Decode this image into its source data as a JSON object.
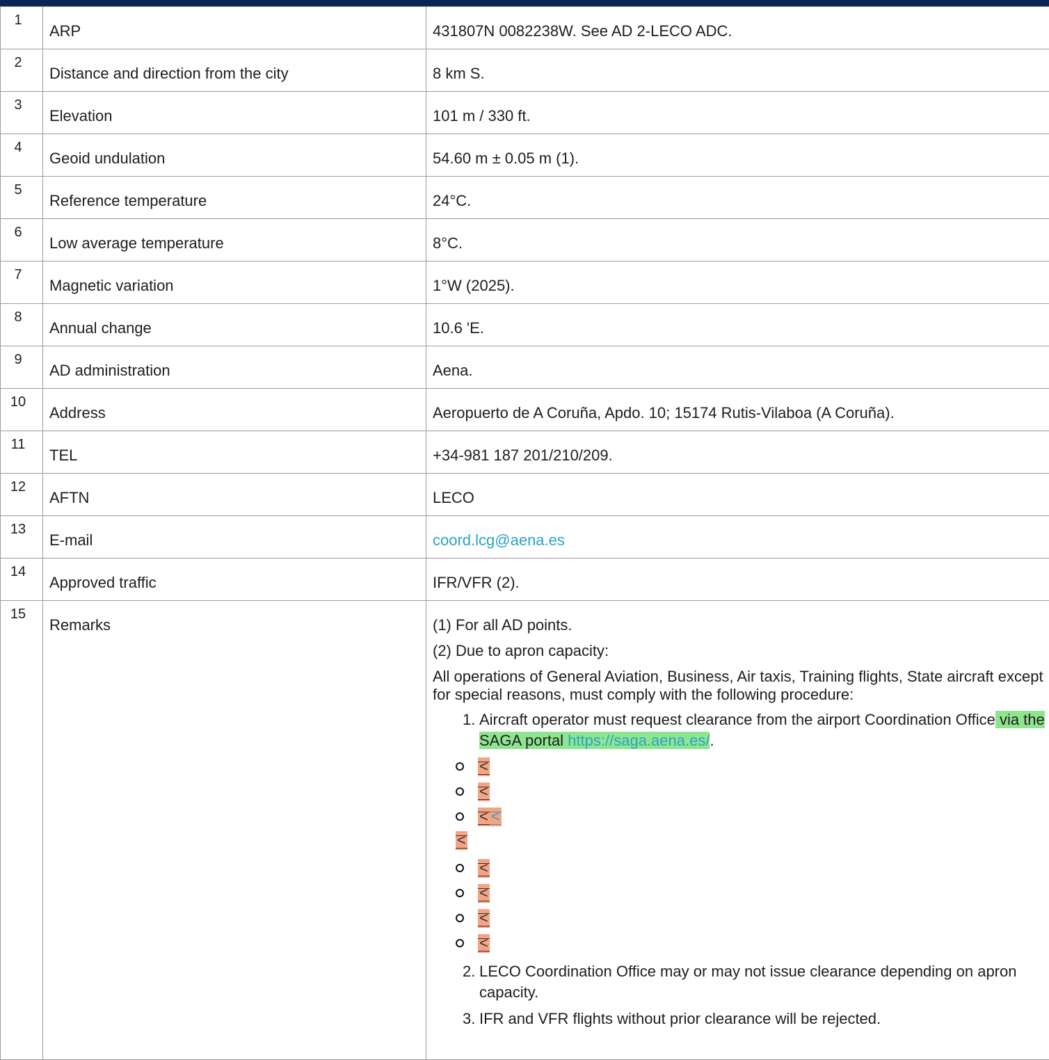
{
  "rows": [
    {
      "num": "1",
      "label": "ARP",
      "value": "431807N 0082238W. See AD 2-LECO ADC."
    },
    {
      "num": "2",
      "label": "Distance and direction from the city",
      "value": "8 km S."
    },
    {
      "num": "3",
      "label": "Elevation",
      "value": "101 m / 330 ft."
    },
    {
      "num": "4",
      "label": "Geoid undulation",
      "value": "54.60 m ± 0.05 m (1)."
    },
    {
      "num": "5",
      "label": "Reference temperature",
      "value": "24°C."
    },
    {
      "num": "6",
      "label": "Low average temperature",
      "value": "8°C."
    },
    {
      "num": "7",
      "label": "Magnetic variation",
      "value": "1°W (2025)."
    },
    {
      "num": "8",
      "label": "Annual change",
      "value": "10.6 'E."
    },
    {
      "num": "9",
      "label": "AD administration",
      "value": "Aena."
    },
    {
      "num": "10",
      "label": "Address",
      "value": "Aeropuerto de A Coruña, Apdo. 10; 15174 Rutis-Vilaboa (A Coruña)."
    },
    {
      "num": "11",
      "label": "TEL",
      "value": "+34-981 187 201/210/209."
    },
    {
      "num": "12",
      "label": "AFTN",
      "value": "LECO"
    },
    {
      "num": "13",
      "label": "E-mail",
      "value": "coord.lcg@aena.es"
    },
    {
      "num": "14",
      "label": "Approved traffic",
      "value": "IFR/VFR (2)."
    }
  ],
  "remarks": {
    "num": "15",
    "label": "Remarks",
    "p1": "(1) For all AD points.",
    "p2": "(2) Due to apron capacity:",
    "p3": "All operations of General Aviation, Business, Air taxis, Training flights, State aircraft except for special reasons, must comply with the following procedure:",
    "item1_idx": "1.",
    "item1_text": "Aircraft operator must request clearance from the airport Coordination Office",
    "item1_highlight": " via the SAGA portal ",
    "item1_link": "https://saga.aena.es/",
    "item1_end": ".",
    "deleted_glyph": "<",
    "item2_idx": "2.",
    "item2_text": "LECO Coordination Office may or may not issue clearance depending on apron capacity.",
    "item3_idx": "3.",
    "item3_text": "IFR and VFR flights without prior clearance will be rejected."
  },
  "colors": {
    "header_bar": "#0b2451",
    "link": "#2aa3c9",
    "insert_highlight": "#8fe58f",
    "delete_highlight": "#f5a383",
    "border": "#9a9a9a"
  }
}
